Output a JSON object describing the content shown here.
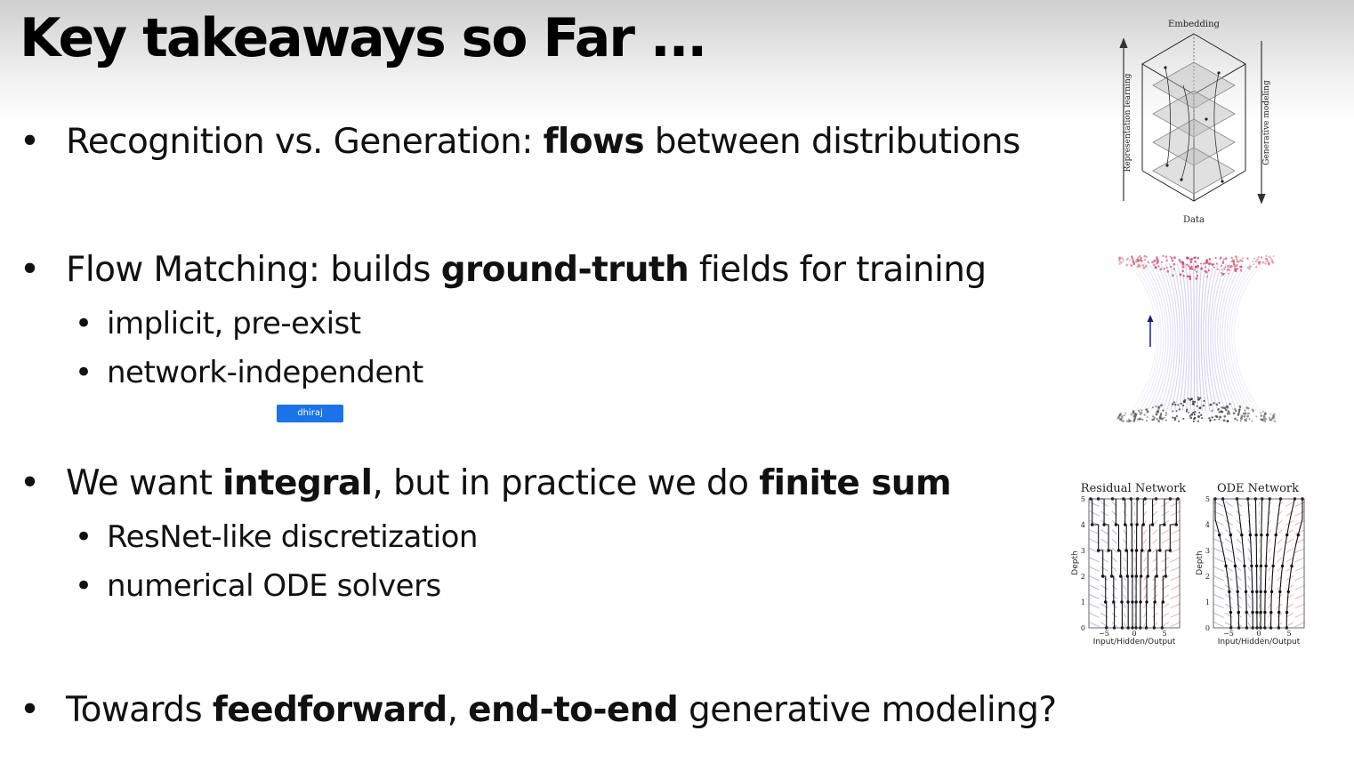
{
  "slide": {
    "title": "Key takeaways so Far ..."
  },
  "bullets": [
    {
      "bullet": "•",
      "parts": [
        {
          "text": "Recognition vs. Generation: ",
          "bold": false
        },
        {
          "text": "flows",
          "bold": true
        },
        {
          "text": " between distributions",
          "bold": false
        }
      ]
    },
    {
      "bullet": "•",
      "parts": [
        {
          "text": "Flow Matching: builds ",
          "bold": false
        },
        {
          "text": "ground-truth",
          "bold": true
        },
        {
          "text": " fields for training",
          "bold": false
        }
      ],
      "subitems": [
        "implicit, pre-exist",
        "network-independent"
      ]
    },
    {
      "bullet": "•",
      "parts": [
        {
          "text": "We want ",
          "bold": false
        },
        {
          "text": "integral",
          "bold": true
        },
        {
          "text": ", but in practice we do ",
          "bold": false
        },
        {
          "text": "finite sum",
          "bold": true
        }
      ],
      "subitems": [
        "ResNet-like discretization",
        "numerical ODE solvers"
      ]
    },
    {
      "bullet": "•",
      "parts": [
        {
          "text": "Towards ",
          "bold": false
        },
        {
          "text": "feedforward",
          "bold": true
        },
        {
          "text": ", ",
          "bold": false
        },
        {
          "text": "end-to-end",
          "bold": true
        },
        {
          "text": " generative modeling?",
          "bold": false
        }
      ]
    }
  ],
  "user_tag": "dhiraj",
  "figures": {
    "embedding": {
      "top_label": "Embedding",
      "bottom_label": "Data",
      "left_label": "Representation learning",
      "right_label": "Generative modeling"
    },
    "flow": {
      "colors": {
        "top": "#d04060",
        "bottom": "#333333",
        "lines": "#9c93d8",
        "arrow": "#1a1a80"
      }
    },
    "resnet": {
      "title": "Residual Network",
      "ylabel": "Depth",
      "xlabel": "Input/Hidden/Output",
      "yticks": [
        "0",
        "1",
        "2",
        "3",
        "4",
        "5"
      ],
      "xticks": [
        "−5",
        "0",
        "5"
      ]
    },
    "ode": {
      "title": "ODE Network",
      "ylabel": "Depth",
      "xlabel": "Input/Hidden/Output",
      "yticks": [
        "0",
        "1",
        "2",
        "3",
        "4",
        "5"
      ],
      "xticks": [
        "−5",
        "0",
        "5"
      ]
    }
  }
}
